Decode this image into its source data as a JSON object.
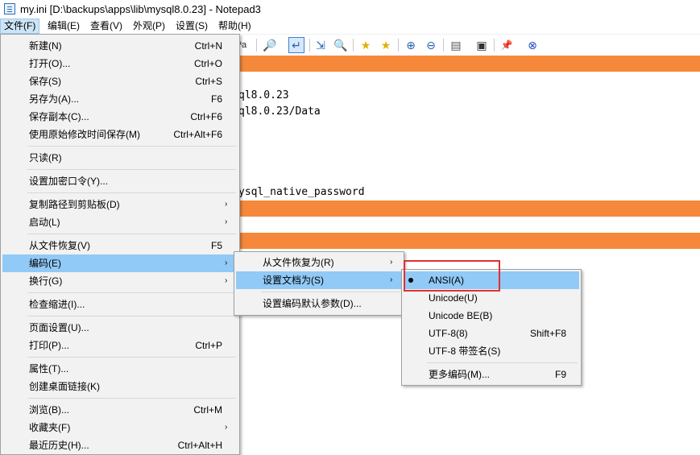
{
  "window": {
    "title": "my.ini [D:\\backups\\apps\\lib\\mysql8.0.23] - Notepad3"
  },
  "menubar": [
    {
      "label": "文件(F)"
    },
    {
      "label": "编辑(E)"
    },
    {
      "label": "查看(V)"
    },
    {
      "label": "外观(P)"
    },
    {
      "label": "设置(S)"
    },
    {
      "label": "帮助(H)"
    }
  ],
  "toolbar": [
    {
      "icon": "format-icon",
      "glyph": "ªa"
    },
    {
      "icon": "find-icon",
      "glyph": "🔎"
    },
    {
      "icon": "word-wrap-icon",
      "glyph": "↵"
    },
    {
      "icon": "go-to-icon",
      "glyph": "⇲"
    },
    {
      "icon": "find-next-icon",
      "glyph": "🔍"
    },
    {
      "icon": "favorites-icon",
      "glyph": "★"
    },
    {
      "icon": "add-favorite-icon",
      "glyph": "★"
    },
    {
      "icon": "zoom-in-icon",
      "glyph": "⊕"
    },
    {
      "icon": "zoom-out-icon",
      "glyph": "⊖"
    },
    {
      "icon": "schemes-icon",
      "glyph": "▤"
    },
    {
      "icon": "customize-schemes-icon",
      "glyph": "▣"
    },
    {
      "icon": "pin-icon",
      "glyph": "📌"
    },
    {
      "icon": "close-icon",
      "glyph": "⊗"
    }
  ],
  "editor": {
    "visible_lines": [
      "ql8.0.23",
      "ql8.0.23/Data",
      "ysql_native_password"
    ]
  },
  "file_menu": {
    "items": [
      {
        "label": "新建(N)",
        "shortcut": "Ctrl+N"
      },
      {
        "label": "打开(O)...",
        "shortcut": "Ctrl+O"
      },
      {
        "label": "保存(S)",
        "shortcut": "Ctrl+S"
      },
      {
        "label": "另存为(A)...",
        "shortcut": "F6"
      },
      {
        "label": "保存副本(C)...",
        "shortcut": "Ctrl+F6"
      },
      {
        "label": "使用原始修改时间保存(M)",
        "shortcut": "Ctrl+Alt+F6"
      },
      {
        "label": "只读(R)",
        "shortcut": ""
      },
      {
        "label": "设置加密口令(Y)...",
        "shortcut": ""
      },
      {
        "label": "复制路径到剪贴板(D)",
        "shortcut": "",
        "submenu": true
      },
      {
        "label": "启动(L)",
        "shortcut": "",
        "submenu": true
      },
      {
        "label": "从文件恢复(V)",
        "shortcut": "F5"
      },
      {
        "label": "编码(E)",
        "shortcut": "",
        "submenu": true,
        "selected": true
      },
      {
        "label": "换行(G)",
        "shortcut": "",
        "submenu": true
      },
      {
        "label": "检查缩进(I)...",
        "shortcut": ""
      },
      {
        "label": "页面设置(U)...",
        "shortcut": ""
      },
      {
        "label": "打印(P)...",
        "shortcut": "Ctrl+P"
      },
      {
        "label": "属性(T)...",
        "shortcut": ""
      },
      {
        "label": "创建桌面链接(K)",
        "shortcut": ""
      },
      {
        "label": "浏览(B)...",
        "shortcut": "Ctrl+M"
      },
      {
        "label": "收藏夹(F)",
        "shortcut": "",
        "submenu": true
      },
      {
        "label": "最近历史(H)...",
        "shortcut": "Ctrl+Alt+H"
      }
    ]
  },
  "encoding_menu": {
    "items": [
      {
        "label": "从文件恢复为(R)",
        "submenu": true
      },
      {
        "label": "设置文档为(S)",
        "submenu": true,
        "selected": true
      },
      {
        "label": "设置编码默认参数(D)..."
      }
    ]
  },
  "set_as_menu": {
    "items": [
      {
        "label": "ANSI(A)",
        "shortcut": "",
        "checked": true,
        "selected": true
      },
      {
        "label": "Unicode(U)",
        "shortcut": ""
      },
      {
        "label": "Unicode BE(B)",
        "shortcut": ""
      },
      {
        "label": "UTF-8(8)",
        "shortcut": "Shift+F8"
      },
      {
        "label": "UTF-8 带签名(S)",
        "shortcut": ""
      },
      {
        "label": "更多编码(M)...",
        "shortcut": "F9"
      }
    ]
  },
  "colors": {
    "highlight_line": "#f5883a",
    "menu_selection": "#91c9f7",
    "annotation_box": "#e03030"
  }
}
